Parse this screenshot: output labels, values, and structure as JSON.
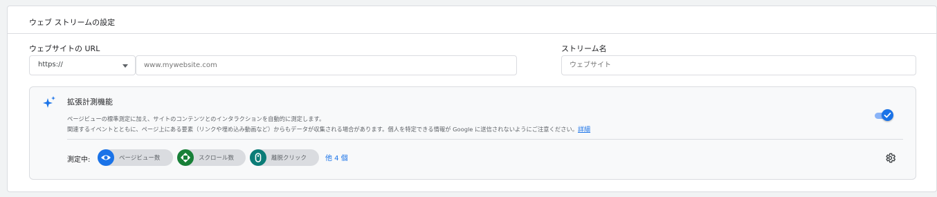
{
  "header": {
    "title": "ウェブ ストリームの設定"
  },
  "url_field": {
    "label": "ウェブサイトの URL",
    "protocol": "https://",
    "placeholder": "www.mywebsite.com"
  },
  "stream_name": {
    "label": "ストリーム名",
    "placeholder": "ウェブサイト"
  },
  "enhanced": {
    "icon": "sparkle-icon",
    "title": "拡張計測機能",
    "description_line1": "ページビューの標準測定に加え、サイトのコンテンツとのインタラクションを自動的に測定します。",
    "description_line2": "関連するイベントとともに、ページ上にある要素（リンクや埋め込み動画など）からもデータが収集される場合があります。個人を特定できる情報が Google に送信されないようにご注意ください。",
    "details_link": "詳細",
    "toggle_on": true,
    "measuring_label": "測定中:",
    "chips": [
      {
        "label": "ページビュー数",
        "icon": "eye-icon",
        "color": "#1a73e8"
      },
      {
        "label": "スクロール数",
        "icon": "scroll-icon",
        "color": "#188038"
      },
      {
        "label": "離脱クリック",
        "icon": "mouse-icon",
        "color": "#0b7c77"
      }
    ],
    "more_link": "他 4 個",
    "settings_icon": "gear-icon"
  },
  "colors": {
    "accent": "#1a73e8",
    "toggle_track": "#8ab4f8"
  }
}
